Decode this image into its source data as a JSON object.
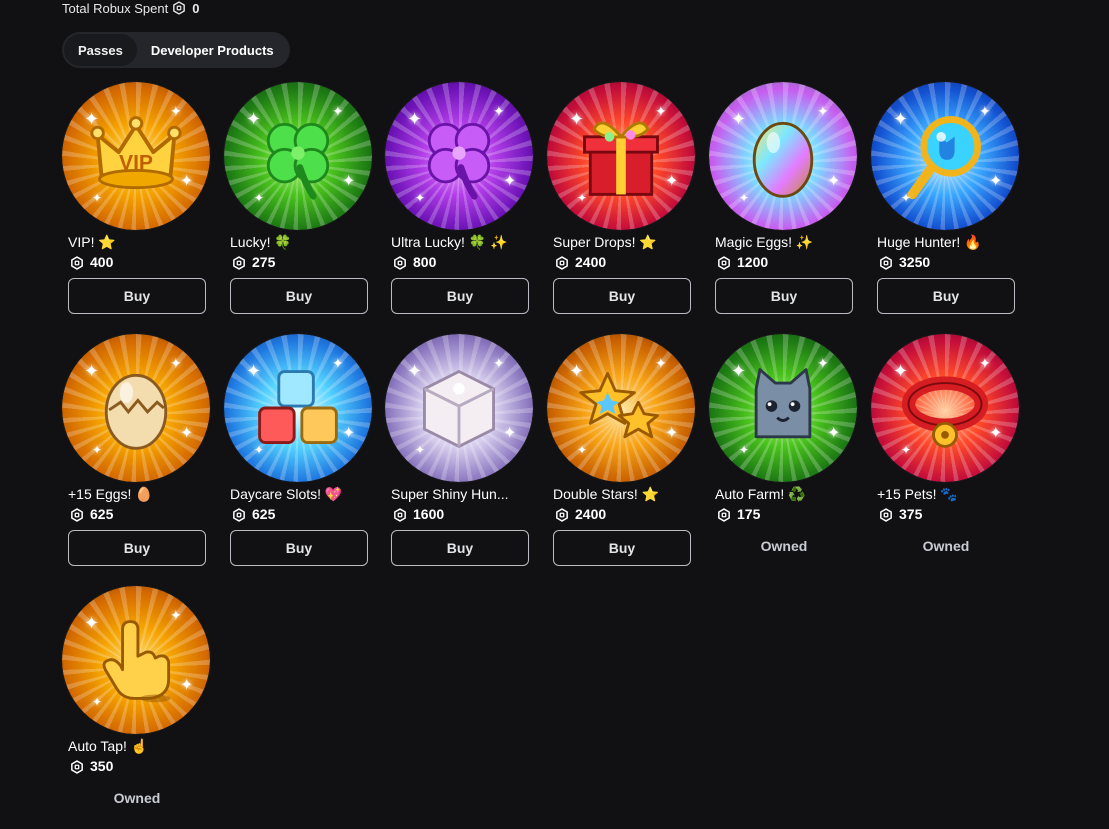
{
  "header": {
    "label": "Total Robux Spent",
    "value": "0"
  },
  "tabs": [
    {
      "label": "Passes",
      "active": true
    },
    {
      "label": "Developer Products",
      "active": false
    }
  ],
  "colors": {
    "background": "#111114",
    "tab_bar": "#25262b",
    "button_border": "#b9bcc2"
  },
  "passes": [
    {
      "name": "VIP! ⭐",
      "price": "400",
      "status": "buy",
      "icon": "vip-crown-icon",
      "theme": "gold",
      "button_label": "Buy"
    },
    {
      "name": "Lucky! 🍀",
      "price": "275",
      "status": "buy",
      "icon": "four-leaf-clover-icon",
      "theme": "green",
      "button_label": "Buy"
    },
    {
      "name": "Ultra Lucky! 🍀 ✨",
      "price": "800",
      "status": "buy",
      "icon": "purple-clover-icon",
      "theme": "purple",
      "button_label": "Buy"
    },
    {
      "name": "Super Drops! ⭐",
      "price": "2400",
      "status": "buy",
      "icon": "gift-box-icon",
      "theme": "red",
      "button_label": "Buy"
    },
    {
      "name": "Magic Eggs! ✨",
      "price": "1200",
      "status": "buy",
      "icon": "rainbow-egg-icon",
      "theme": "rainbow",
      "button_label": "Buy"
    },
    {
      "name": "Huge Hunter! 🔥",
      "price": "3250",
      "status": "buy",
      "icon": "magnifying-glass-icon",
      "theme": "blue",
      "button_label": "Buy"
    },
    {
      "name": "+15 Eggs! 🥚",
      "price": "625",
      "status": "buy",
      "icon": "cracked-egg-icon",
      "theme": "gold",
      "button_label": "Buy"
    },
    {
      "name": "Daycare Slots! 💖",
      "price": "625",
      "status": "buy",
      "icon": "blocks-icon",
      "theme": "cyan",
      "button_label": "Buy"
    },
    {
      "name": "Super Shiny Hun...",
      "price": "1600",
      "status": "buy",
      "icon": "shiny-cube-icon",
      "theme": "silver",
      "button_label": "Buy"
    },
    {
      "name": "Double Stars! ⭐",
      "price": "2400",
      "status": "buy",
      "icon": "double-stars-icon",
      "theme": "orange",
      "button_label": "Buy"
    },
    {
      "name": "Auto Farm! ♻️",
      "price": "175",
      "status": "owned",
      "icon": "cat-pet-icon",
      "theme": "green",
      "owned_label": "Owned"
    },
    {
      "name": "+15 Pets! 🐾",
      "price": "375",
      "status": "owned",
      "icon": "pet-collar-icon",
      "theme": "red",
      "owned_label": "Owned"
    },
    {
      "name": "Auto Tap! ☝️",
      "price": "350",
      "status": "owned",
      "icon": "tap-hand-icon",
      "theme": "gold",
      "owned_label": "Owned"
    }
  ]
}
